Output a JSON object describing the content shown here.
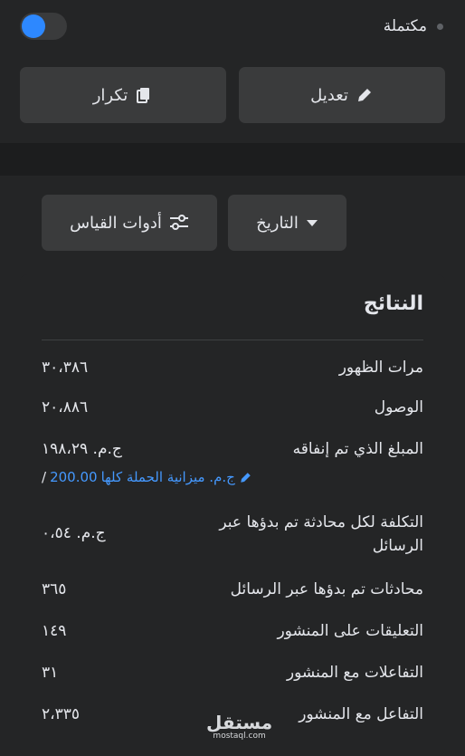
{
  "status": {
    "label": "مكتملة",
    "toggle_on": true,
    "toggle_color": "#2d88ff"
  },
  "actions": {
    "edit_label": "تعديل",
    "duplicate_label": "تكرار"
  },
  "filters": {
    "date_label": "التاريخ",
    "tools_label": "أدوات القياس"
  },
  "results": {
    "title": "النتائج",
    "rows": [
      {
        "label": "مرات الظهور",
        "value": "٣٠،٣٨٦"
      },
      {
        "label": "الوصول",
        "value": "٢٠،٨٨٦"
      },
      {
        "label": "المبلغ الذي تم إنفاقه",
        "value": "ج.م. ١٩٨،٢٩"
      },
      {
        "label": "التكلفة لكل محادثة تم بدؤها عبر الرسائل",
        "value": "ج.م. ٠،٥٤"
      },
      {
        "label": "محادثات تم بدؤها عبر الرسائل",
        "value": "٣٦٥"
      },
      {
        "label": "التعليقات على المنشور",
        "value": "١٤٩"
      },
      {
        "label": "التفاعلات مع المنشور",
        "value": "٣١"
      },
      {
        "label": "التفاعل مع المنشور",
        "value": "٢،٣٣٥"
      }
    ],
    "budget": {
      "amount": "200.00",
      "text": "ج.م. ميزانية الحملة كلها",
      "link_color": "#4599ff"
    }
  },
  "watermark": {
    "brand": "مستقل",
    "domain": "mostaql.com"
  }
}
